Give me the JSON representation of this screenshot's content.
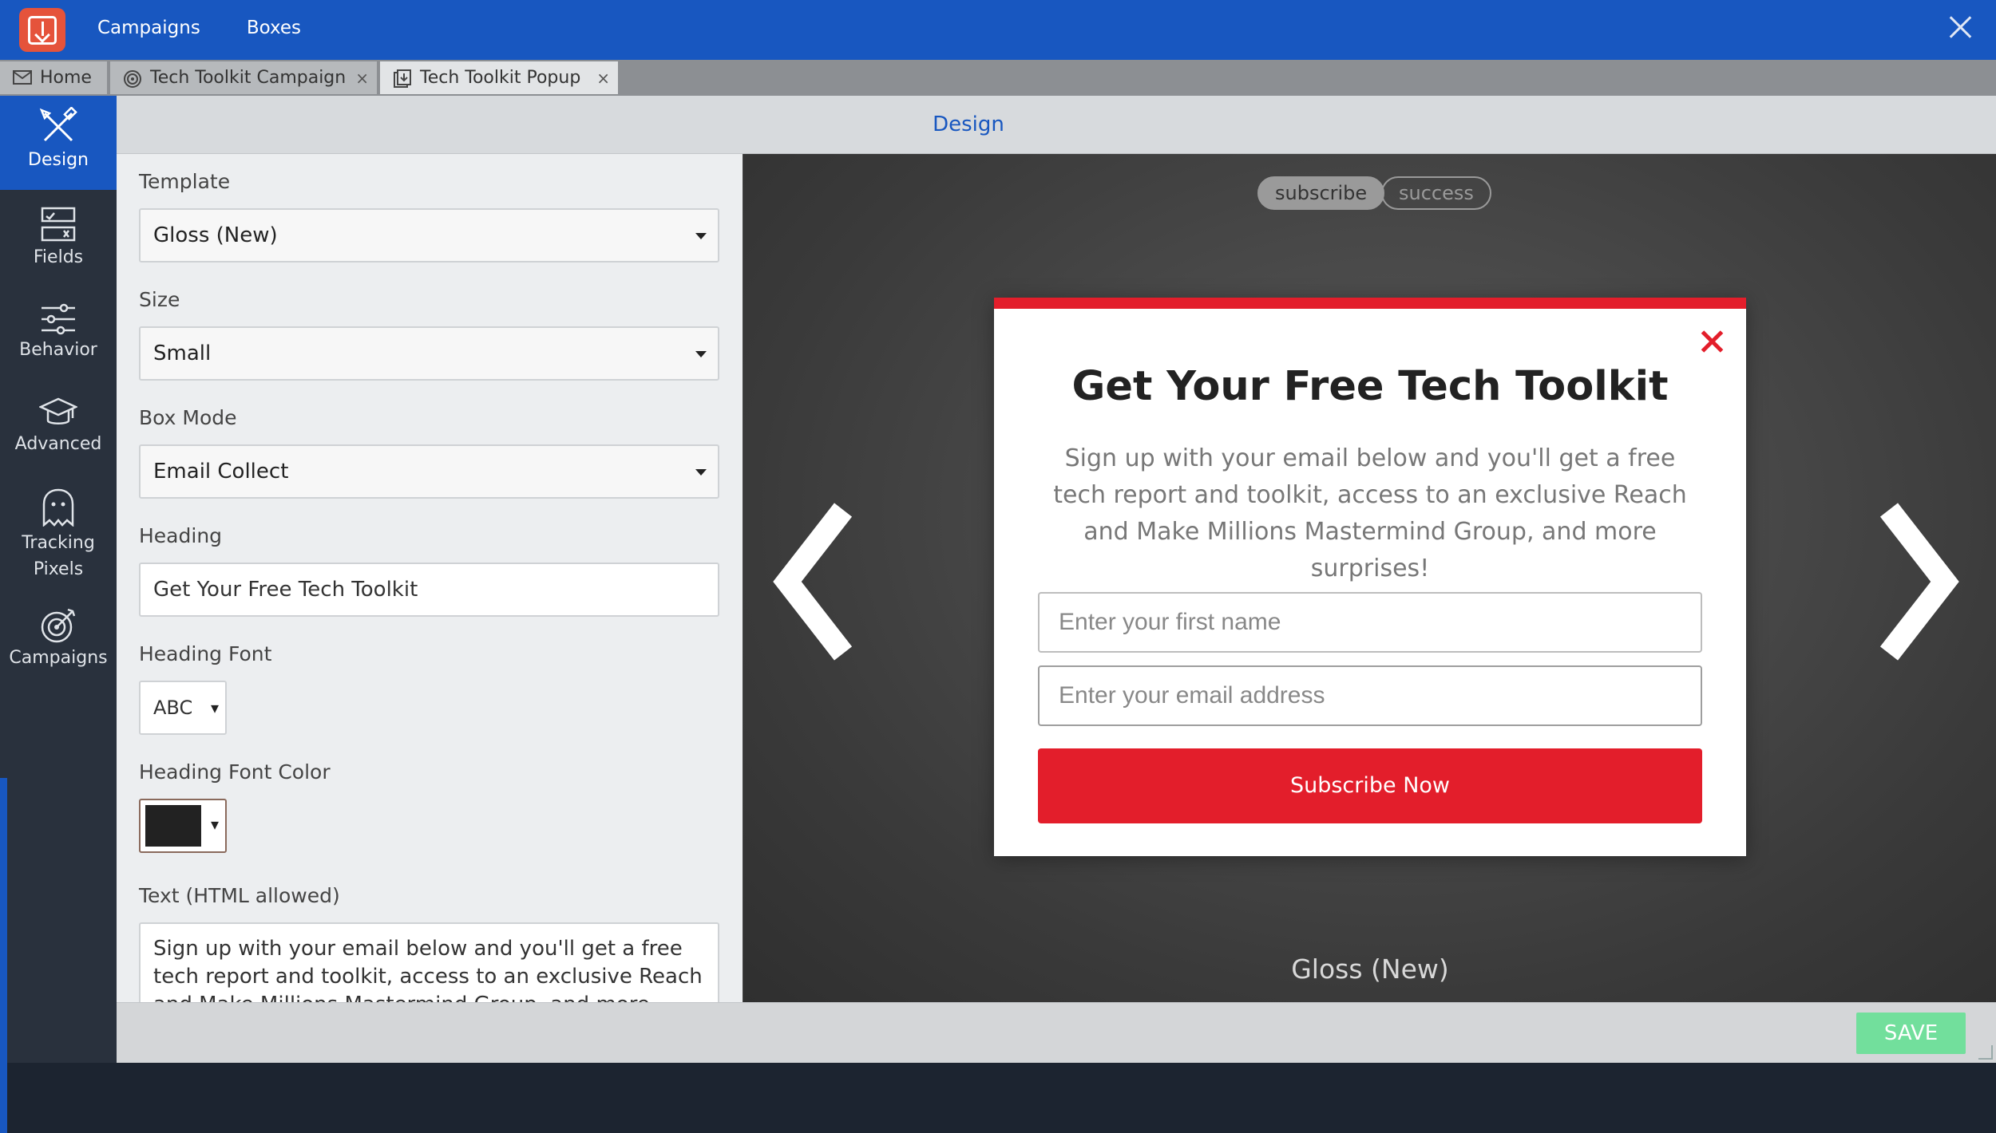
{
  "topbar": {
    "nav": [
      "Campaigns",
      "Boxes"
    ]
  },
  "tabs": [
    {
      "label": "Home",
      "icon": "mail-icon"
    },
    {
      "label": "Tech Toolkit Campaign",
      "icon": "target-icon",
      "close": "×"
    },
    {
      "label": "Tech Toolkit Popup",
      "icon": "popup-icon",
      "close": "×"
    }
  ],
  "sidebar": {
    "items": [
      {
        "label": "Design",
        "icon": "design-tools-icon",
        "active": true
      },
      {
        "label": "Fields",
        "icon": "fields-icon"
      },
      {
        "label": "Behavior",
        "icon": "sliders-icon"
      },
      {
        "label": "Advanced",
        "icon": "graduation-cap-icon"
      },
      {
        "label": "Tracking Pixels",
        "label_line1": "Tracking",
        "label_line2": "Pixels",
        "icon": "ghost-icon"
      },
      {
        "label": "Campaigns",
        "icon": "target-icon"
      }
    ]
  },
  "header": {
    "title": "Design"
  },
  "form": {
    "template_label": "Template",
    "template_value": "Gloss (New)",
    "size_label": "Size",
    "size_value": "Small",
    "mode_label": "Box Mode",
    "mode_value": "Email Collect",
    "heading_label": "Heading",
    "heading_value": "Get Your Free Tech Toolkit",
    "heading_font_label": "Heading Font",
    "heading_font_value": "ABC",
    "heading_color_label": "Heading Font Color",
    "heading_color_value": "#222222",
    "text_label": "Text (HTML allowed)",
    "text_value": "Sign up with your email below and you'll get a free tech report and toolkit, access to an exclusive Reach and Make Millions Mastermind Group, and more surprises!",
    "dropdown_arrow": "▾"
  },
  "preview": {
    "toggle_subscribe": "subscribe",
    "toggle_success": "success",
    "caption": "Gloss (New)",
    "popup": {
      "heading": "Get Your Free Tech Toolkit",
      "text": "Sign up with your email below and you'll get a free tech report and toolkit, access to an exclusive Reach and Make Millions Mastermind Group, and more surprises!",
      "first_name_placeholder": "Enter your first name",
      "email_placeholder": "Enter your email address",
      "button": "Subscribe Now",
      "accent_color": "#e31e2b"
    }
  },
  "footer": {
    "save": "SAVE"
  },
  "colors": {
    "topbar": "#1857c0",
    "sidebar": "#29313d",
    "save": "#72df9c"
  }
}
